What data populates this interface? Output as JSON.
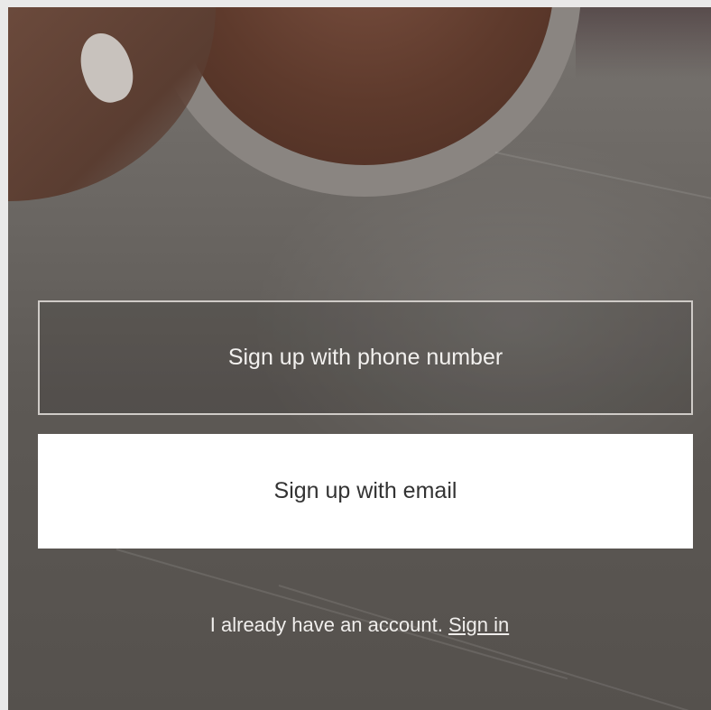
{
  "actions": {
    "phone_signup_label": "Sign up with phone number",
    "email_signup_label": "Sign up with email"
  },
  "signin": {
    "prompt": "I already have an account. ",
    "link_label": "Sign in"
  }
}
